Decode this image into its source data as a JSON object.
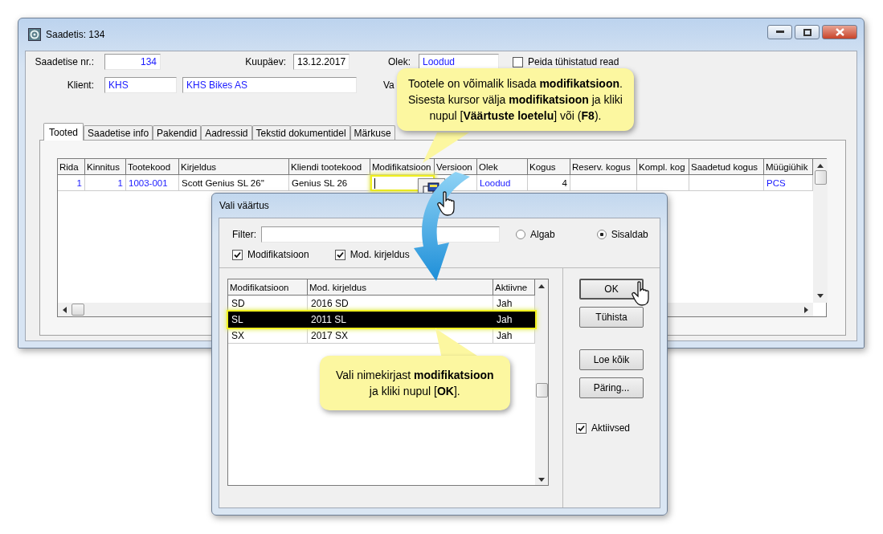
{
  "window": {
    "title": "Saadetis: 134"
  },
  "header": {
    "number_label": "Saadetise nr.:",
    "number": "134",
    "date_label": "Kuupäev:",
    "date": "13.12.2017",
    "status_label": "Olek:",
    "status": "Loodud",
    "hide_cancelled": {
      "label": "Peida tühistatud read",
      "checked": false
    },
    "client_label": "Klient:",
    "client_code": "KHS",
    "client_name": "KHS Bikes AS",
    "partial_label": "Va"
  },
  "tabs": [
    {
      "label": "Tooted",
      "selected": true
    },
    {
      "label": "Saadetise info",
      "selected": false
    },
    {
      "label": "Pakendid",
      "selected": false
    },
    {
      "label": "Aadressid",
      "selected": false
    },
    {
      "label": "Tekstid dokumentidel",
      "selected": false
    },
    {
      "label": "Märkuse",
      "selected": false
    }
  ],
  "table": {
    "columns": [
      "Rida",
      "Kinnitus",
      "Tootekood",
      "Kirjeldus",
      "Kliendi tootekood",
      "Modifikatsioon",
      "Versioon",
      "Olek",
      "Kogus",
      "Reserv. kogus",
      "Kompl. kog",
      "Saadetud kogus",
      "Müügiühik"
    ],
    "rows": [
      {
        "cells": [
          "1",
          "1",
          "1003-001",
          "Scott Genius SL 26''",
          "Genius SL 26",
          "",
          "",
          "Loodud",
          "4",
          "",
          "",
          "",
          "PCS"
        ]
      }
    ]
  },
  "dialog": {
    "title": "Vali väärtus",
    "filter_label": "Filter:",
    "match_modes": [
      {
        "label": "Algab",
        "selected": false
      },
      {
        "label": "Sisaldab",
        "selected": true
      }
    ],
    "search_fields": [
      {
        "label": "Modifikatsioon",
        "checked": true
      },
      {
        "label": "Mod. kirjeldus",
        "checked": true
      }
    ],
    "list": {
      "columns": [
        "Modifikatsioon",
        "Mod. kirjeldus",
        "Aktiivne"
      ],
      "rows": [
        {
          "cells": [
            "SD",
            "2016 SD",
            "Jah"
          ],
          "selected": false
        },
        {
          "cells": [
            "SL",
            "2011 SL",
            "Jah"
          ],
          "selected": true
        },
        {
          "cells": [
            "SX",
            "2017 SX",
            "Jah"
          ],
          "selected": false
        }
      ]
    },
    "buttons": [
      "OK",
      "Tühista",
      "Loe kõik",
      "Päring..."
    ],
    "active_only": {
      "label": "Aktiivsed",
      "checked": true
    }
  },
  "callouts": [
    {
      "lines": [
        "Tootele on võimalik lisada **modifikatsioon**.",
        "Sisesta kursor välja **modifikatsioon** ja kliki",
        "nupul [**Väärtuste loetelu**] või (**F8**)."
      ]
    },
    {
      "lines": [
        "Vali nimekirjast **modifikatsioon**",
        "ja kliki nupul [**OK**]."
      ]
    }
  ]
}
